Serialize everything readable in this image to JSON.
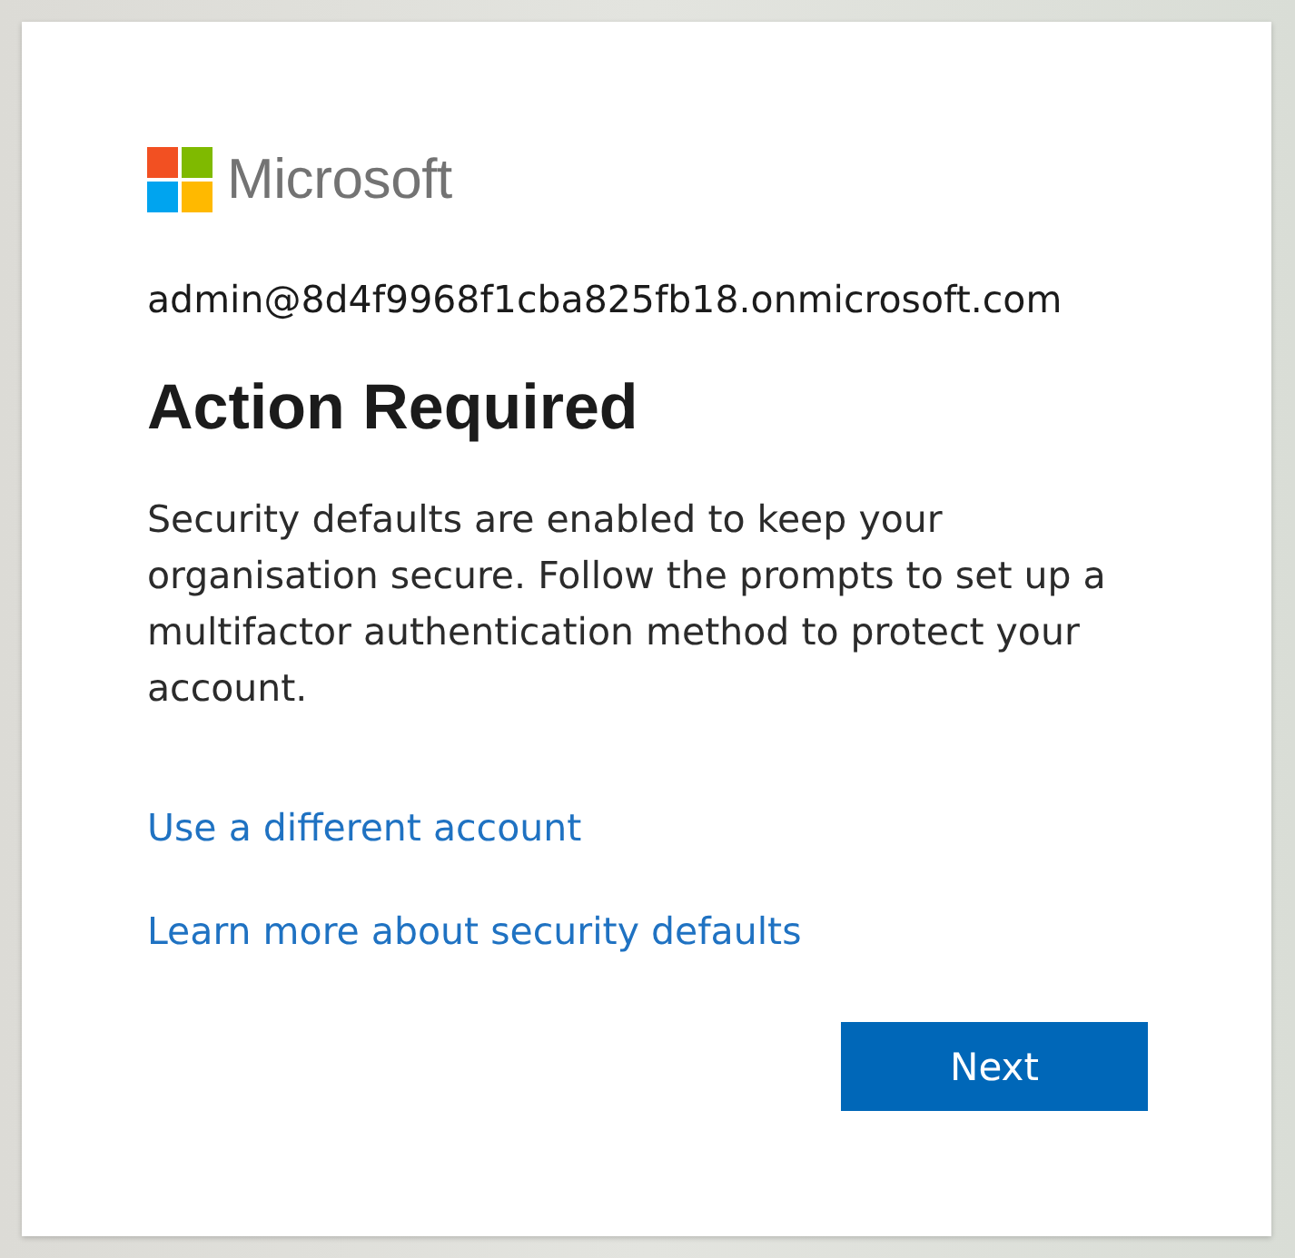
{
  "logo": {
    "wordmark": "Microsoft"
  },
  "account": "admin@8d4f9968f1cba825fb18.onmicrosoft.com",
  "heading": "Action Required",
  "message": "Security defaults are enabled to keep your organisation secure. Follow the prompts to set up a multifactor authentication method to protect your account.",
  "links": [
    "Use a different account",
    "Learn more about security defaults"
  ],
  "button": {
    "label": "Next"
  }
}
